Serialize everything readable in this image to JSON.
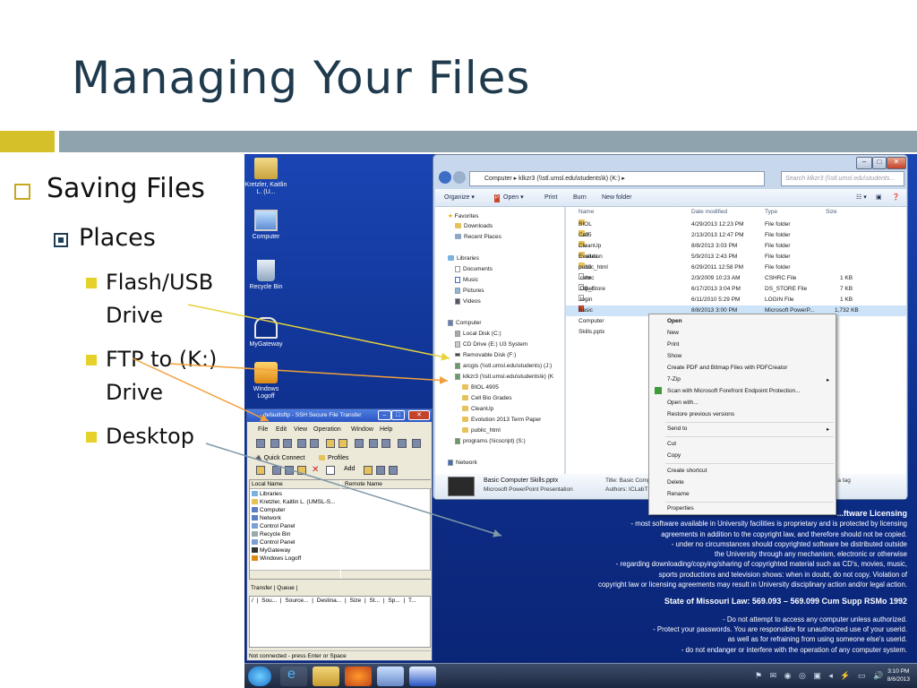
{
  "slide": {
    "title": "Managing Your Files",
    "bullets": {
      "level1": "Saving Files",
      "level2": "Places",
      "level3": [
        {
          "line1": "Flash/USB",
          "line2": "Drive"
        },
        {
          "line1": "FTP to (K:)",
          "line2": "Drive"
        },
        {
          "line1": "Desktop",
          "line2": ""
        }
      ]
    },
    "accent_colors": {
      "yellow": "#d4c12a",
      "bluegray": "#8ea3ad",
      "title": "#1f3a4d"
    }
  },
  "desktop_icons": [
    {
      "label": "Kretzler, Kaitlin L. (U...",
      "icon": "user-folder-icon"
    },
    {
      "label": "Computer",
      "icon": "computer-icon"
    },
    {
      "label": "Recycle Bin",
      "icon": "recycle-bin-icon"
    },
    {
      "label": "MyGateway",
      "icon": "mygateway-icon"
    },
    {
      "label": "Windows Logoff",
      "icon": "logoff-icon"
    }
  ],
  "explorer": {
    "address": "Computer ▸ klkzr3 (\\\\stl.umsl.edu\\students\\k) (K:) ▸",
    "search_placeholder": "Search klkzr3 (\\\\stl.umsl.edu\\students...",
    "toolbar": [
      "Organize ▾",
      "Open ▾",
      "Print",
      "Burn",
      "New folder"
    ],
    "nav": {
      "favorites": "Favorites",
      "favorites_items": [
        "Downloads",
        "Recent Places"
      ],
      "libraries": "Libraries",
      "libraries_items": [
        "Documents",
        "Music",
        "Pictures",
        "Videos"
      ],
      "computer": "Computer",
      "computer_items": [
        "Local Disk (C:)",
        "CD Drive (E:) U3 System",
        "Removable Disk (F:)",
        "arcgis (\\\\stl.umsl.edu\\students) (J:)",
        "klkzr3 (\\\\stl.umsl.edu\\students\\k) (K"
      ],
      "k_subitems": [
        "BIOL 4905",
        "Cell Bio Grades",
        "CleanUp",
        "Evolution 2013 Term Paper",
        "public_html"
      ],
      "programs": "programs (\\\\icscript) (S:)",
      "network": "Network"
    },
    "columns": [
      "Name",
      "Date modified",
      "Type",
      "Size"
    ],
    "files": [
      {
        "name": "BIOL 4905",
        "date": "4/29/2013 12:23 PM",
        "type": "File folder",
        "size": "",
        "kind": "folder"
      },
      {
        "name": "Cell Bio Grades",
        "date": "2/13/2013 12:47 PM",
        "type": "File folder",
        "size": "",
        "kind": "folder"
      },
      {
        "name": "CleanUp",
        "date": "8/8/2013 3:03 PM",
        "type": "File folder",
        "size": "",
        "kind": "folder"
      },
      {
        "name": "Evolution 2013 Term Paper",
        "date": "5/9/2013 2:43 PM",
        "type": "File folder",
        "size": "",
        "kind": "folder"
      },
      {
        "name": "public_html",
        "date": "6/29/2011 12:58 PM",
        "type": "File folder",
        "size": "",
        "kind": "folder"
      },
      {
        "name": ".cshrc",
        "date": "2/3/2009 10:23 AM",
        "type": "CSHRC File",
        "size": "1 KB",
        "kind": "file"
      },
      {
        "name": ".DS_Store",
        "date": "6/17/2013 3:04 PM",
        "type": "DS_STORE File",
        "size": "7 KB",
        "kind": "file"
      },
      {
        "name": ".login",
        "date": "6/11/2010 5:29 PM",
        "type": "LOGIN File",
        "size": "1 KB",
        "kind": "file"
      },
      {
        "name": "Basic Computer Skills.pptx",
        "date": "8/8/2013 3:00 PM",
        "type": "Microsoft PowerP...",
        "size": "1,732 KB",
        "kind": "pptx"
      }
    ],
    "detail": {
      "filename": "Basic Computer Skills.pptx",
      "filetype": "Microsoft PowerPoint Presentation",
      "title_label": "Title: Basic Comput",
      "authors_label": "Authors: ICLabTEC User",
      "tag_hint": "d a tag"
    }
  },
  "context_menu": [
    {
      "label": "Open",
      "bold": true
    },
    {
      "label": "New"
    },
    {
      "label": "Print"
    },
    {
      "label": "Show"
    },
    {
      "label": "Create PDF and Bitmap Files with PDFCreator"
    },
    {
      "label": "7-Zip",
      "submenu": true
    },
    {
      "label": "Scan with Microsoft Forefront Endpoint Protection..."
    },
    {
      "label": "Open with..."
    },
    {
      "label": "Restore previous versions"
    },
    {
      "label": "Send to",
      "submenu": true
    },
    {
      "label": "Cut"
    },
    {
      "label": "Copy"
    },
    {
      "label": "Create shortcut"
    },
    {
      "label": "Delete"
    },
    {
      "label": "Rename"
    },
    {
      "label": "Properties"
    }
  ],
  "ssh": {
    "title": "- defaultsftp - SSH Secure File Transfer",
    "menu": [
      "File",
      "Edit",
      "View",
      "Operation",
      "Window",
      "Help"
    ],
    "quick_connect": "Quick Connect",
    "profiles": "Profiles",
    "add_label": "Add",
    "local_header": "Local Name",
    "remote_header": "Remote Name",
    "local_items": [
      "Libraries",
      "Kretzler, Kaitlin L. (UMSL-S...",
      "Computer",
      "Network",
      "Control Panel",
      "Recycle Bin",
      "Control Panel",
      "MyGateway",
      "Windows Logoff"
    ],
    "tabs": [
      "Transfer",
      "Queue"
    ],
    "transfer_cols": [
      "/",
      "Sou...",
      "Source...",
      "Destina...",
      "Size",
      "St...",
      "Sp...",
      "T..."
    ],
    "status": "Not connected - press Enter or Space"
  },
  "licensing": {
    "heading": "...ftware Licensing",
    "lines": [
      "- most software available in University facilities is proprietary and is protected by licensing",
      "agreements in addition to the copyright law, and therefore should not be copied.",
      "- under no circumstances should copyrighted software be distributed outside",
      "the University through any mechanism, electronic or otherwise",
      "- regarding downloading/copying/sharing of copyrighted material such as CD's, movies, music,",
      "sports productions and television shows: when in doubt, do not copy.  Violation of",
      "copyright law or licensing agreements may result in University disciplinary action and/or legal action."
    ],
    "law": "State of Missouri Law:  569.093 – 569.099 Cum Supp RSMo 1992",
    "lines2": [
      "- Do not attempt to access any computer unless authorized.",
      "- Protect your passwords.  You are responsible for unauthorized use of your userid.",
      "as well as for refraining from using someone else's userid.",
      "- do not endanger or interfere with the operation of any computer system."
    ]
  },
  "taskbar": {
    "time": "3:10 PM",
    "date": "8/8/2013"
  }
}
